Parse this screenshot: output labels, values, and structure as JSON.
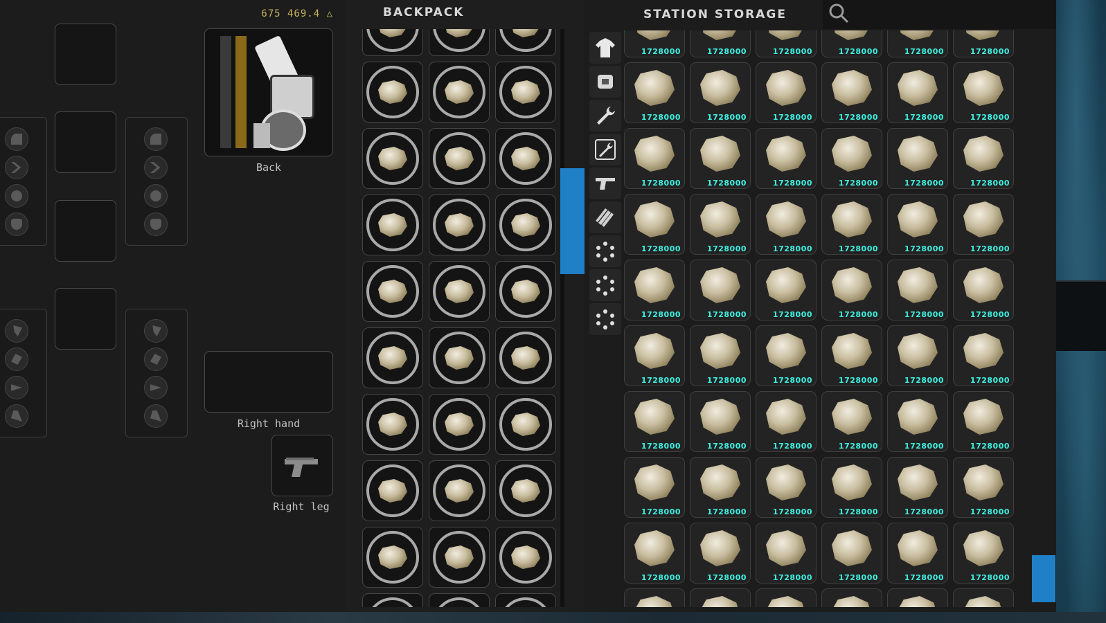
{
  "credits": {
    "amount": "675 469.4",
    "icon": "credits-icon"
  },
  "character": {
    "back_label": "Back",
    "right_hand_label": "Right hand",
    "right_leg_label": "Right leg",
    "right_leg_item_icon": "pistol-icon",
    "back_item_icon": "jetpack-icon"
  },
  "backpack": {
    "title": "BACKPACK",
    "item_icon": "ore-icon"
  },
  "storage": {
    "title": "STATION STORAGE",
    "search_icon": "search-icon",
    "item_count": "1728000",
    "categories": [
      "clothing-icon",
      "armor-icon",
      "wrench-icon",
      "tool-frame-icon",
      "pistol-icon",
      "ammo-icon",
      "dots-icon",
      "dots-icon",
      "dots-icon"
    ]
  },
  "colors": {
    "accent_blue": "#1f7fc7",
    "count_cyan": "#3ef0e0",
    "credits_gold": "#c9b55a"
  }
}
